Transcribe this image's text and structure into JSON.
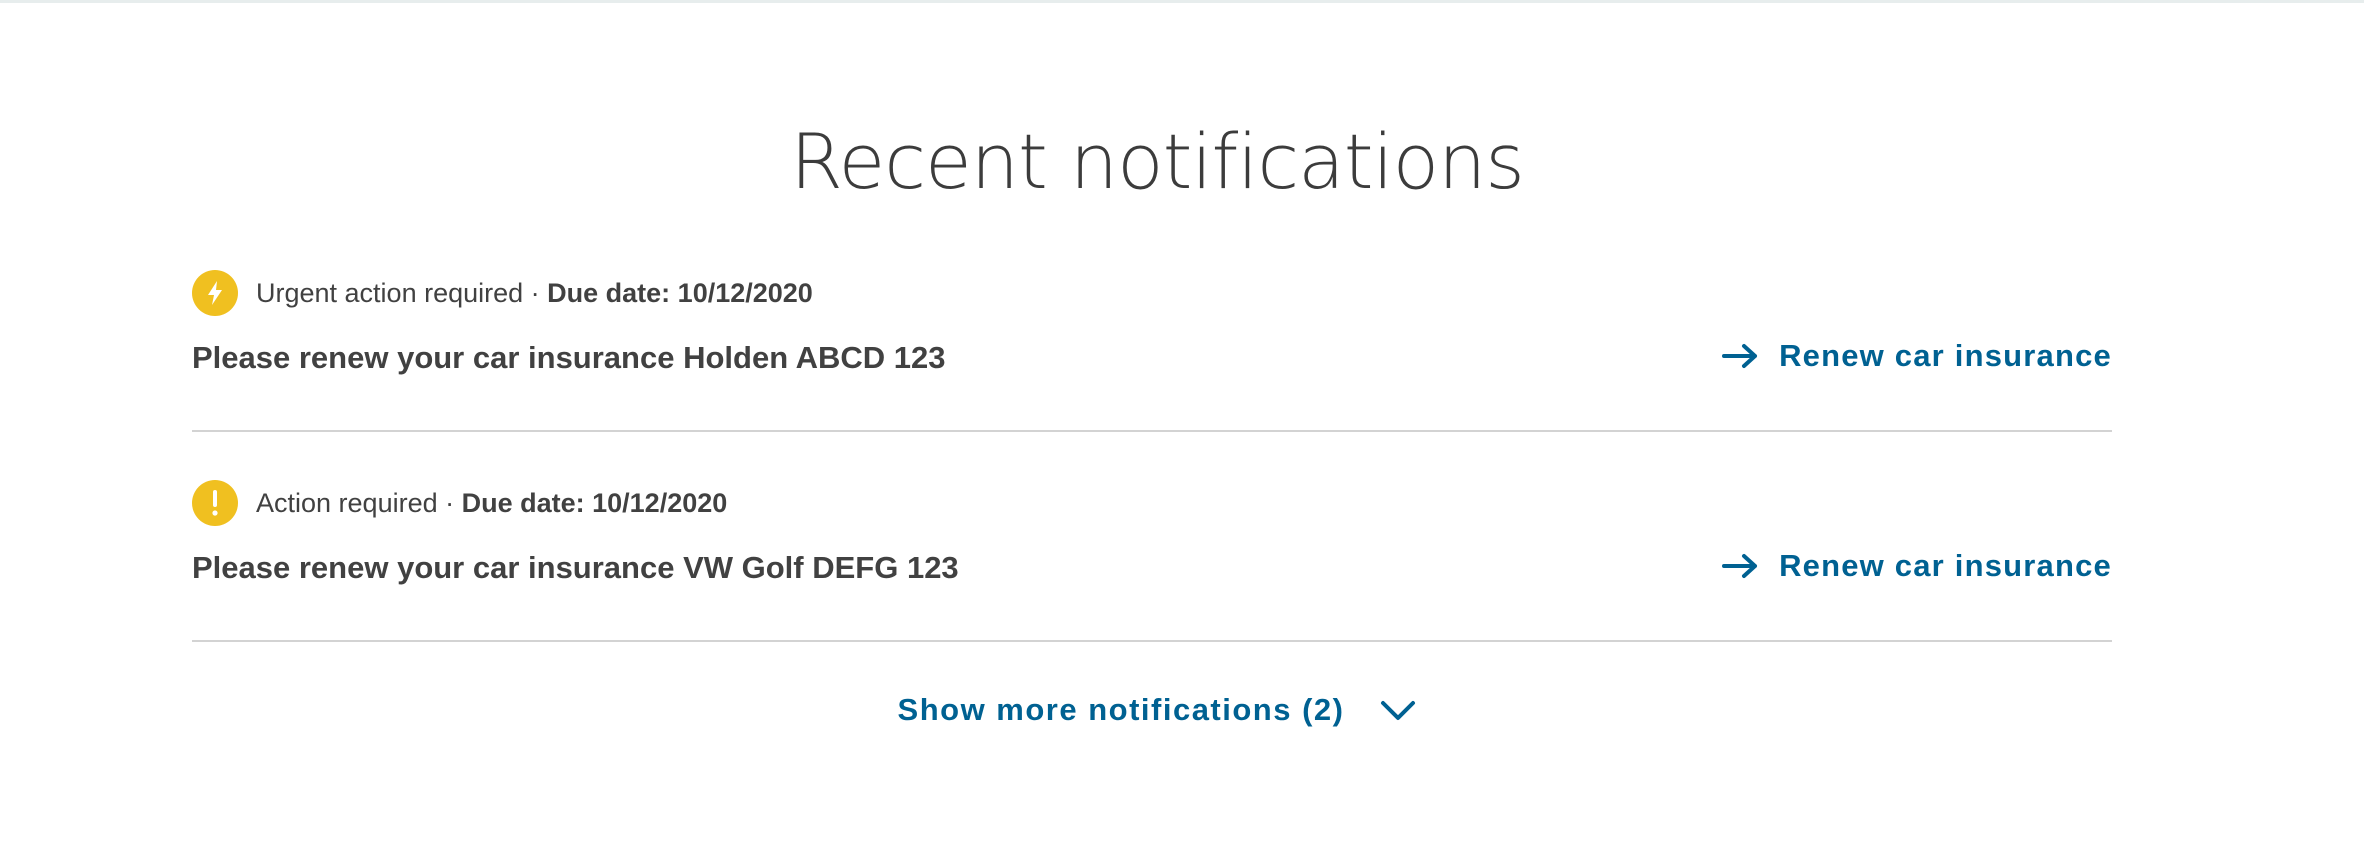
{
  "title": "Recent notifications",
  "notifications": [
    {
      "icon": "lightning-icon",
      "status": "Urgent action required",
      "separator": " · ",
      "due": "Due date: 10/12/2020",
      "message": "Please renew your car insurance Holden ABCD 123",
      "action_label": "Renew car insurance"
    },
    {
      "icon": "exclamation-icon",
      "status": "Action required",
      "separator": " · ",
      "due": "Due date: 10/12/2020",
      "message": "Please renew your car insurance VW Golf DEFG 123",
      "action_label": "Renew car insurance"
    }
  ],
  "show_more": {
    "label": "Show more notifications (2)"
  },
  "colors": {
    "accent": "#006192",
    "warning": "#f0c020",
    "text": "#414141",
    "divider": "#d3d3d3"
  }
}
